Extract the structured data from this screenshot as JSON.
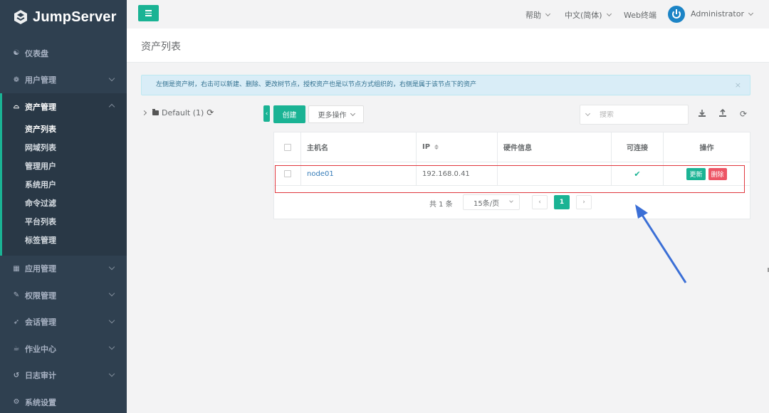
{
  "app": {
    "brand": "JumpServer"
  },
  "sidebar": {
    "items": [
      {
        "id": "dashboard",
        "label": "仪表盘",
        "icon": "dashboard-icon",
        "glyph": "☯",
        "expandable": false
      },
      {
        "id": "users",
        "label": "用户管理",
        "icon": "users-icon",
        "glyph": "❁",
        "expandable": true
      },
      {
        "id": "assets",
        "label": "资产管理",
        "icon": "inbox-icon",
        "glyph": "⌓",
        "expandable": true,
        "active": true,
        "children": [
          "资产列表",
          "网域列表",
          "管理用户",
          "系统用户",
          "命令过滤",
          "平台列表",
          "标签管理"
        ]
      },
      {
        "id": "apps",
        "label": "应用管理",
        "icon": "grid-icon",
        "glyph": "▦",
        "expandable": true
      },
      {
        "id": "perms",
        "label": "权限管理",
        "icon": "edit-icon",
        "glyph": "✎",
        "expandable": true
      },
      {
        "id": "sessions",
        "label": "会话管理",
        "icon": "rocket-icon",
        "glyph": "➶",
        "expandable": true
      },
      {
        "id": "ops",
        "label": "作业中心",
        "icon": "coffee-icon",
        "glyph": "☕",
        "expandable": true
      },
      {
        "id": "audits",
        "label": "日志审计",
        "icon": "history-icon",
        "glyph": "↺",
        "expandable": true
      },
      {
        "id": "settings",
        "label": "系统设置",
        "icon": "gears-icon",
        "glyph": "⚙",
        "expandable": false
      }
    ]
  },
  "topbar": {
    "help": "帮助",
    "language": "中文(简体)",
    "web_terminal": "Web终端",
    "user": "Administrator"
  },
  "page": {
    "title": "资产列表"
  },
  "alert": {
    "text": "左侧是资产树，右击可以新建、删除、更改树节点，授权资产也是以节点方式组织的，右侧是属于该节点下的资产",
    "close": "×"
  },
  "tree": {
    "root_label": "Default (1)"
  },
  "toolbar": {
    "toggle": "‹",
    "create": "创建",
    "more_actions": "更多操作",
    "search_placeholder": "搜索",
    "icons": [
      "download-icon",
      "upload-icon",
      "refresh-icon"
    ]
  },
  "table": {
    "columns": [
      "主机名",
      "IP",
      "硬件信息",
      "可连接",
      "操作"
    ],
    "rows": [
      {
        "hostname": "node01",
        "ip": "192.168.0.41",
        "hardware": "",
        "connectable": "✔",
        "actions": [
          "更新",
          "删除"
        ]
      }
    ]
  },
  "pagination": {
    "total": "共 1 条",
    "per_page": "15条/页",
    "prev": "‹",
    "current_page": "1",
    "next": "›"
  },
  "colors": {
    "sidebar_bg": "#2f4050",
    "accent": "#1ab394",
    "danger": "#ed5565",
    "annotation_red": "#e0383e",
    "annotation_arrow": "#3b6fd6"
  }
}
